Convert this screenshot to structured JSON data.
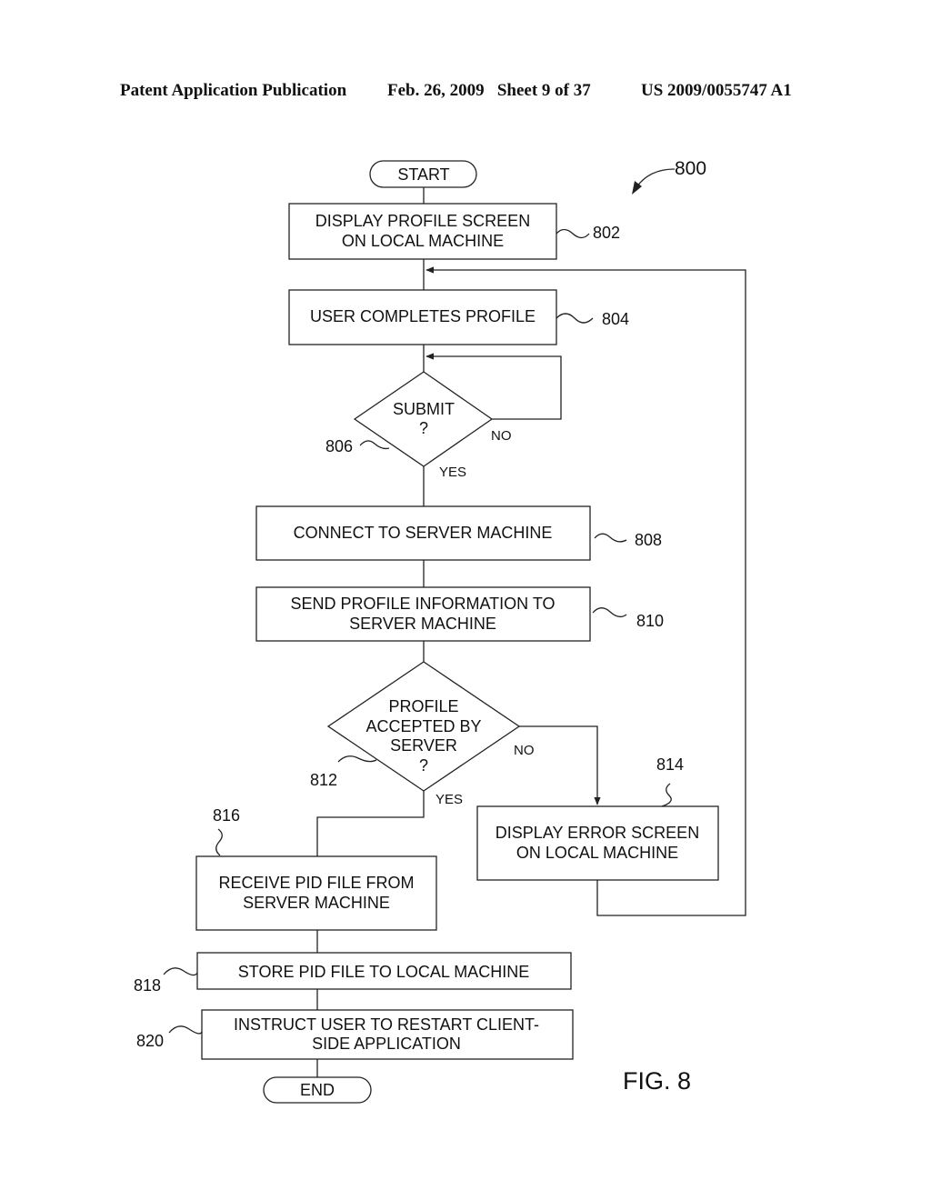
{
  "header": {
    "publication": "Patent Application Publication",
    "date_sheet": "Feb. 26, 2009   Sheet 9 of 37",
    "number": "US 2009/0055747 A1"
  },
  "figure": {
    "label": "FIG. 8",
    "ref": "800"
  },
  "nodes": {
    "start": {
      "lines": [
        "START"
      ]
    },
    "n802": {
      "ref": "802",
      "lines": [
        "DISPLAY PROFILE SCREEN",
        "ON LOCAL MACHINE"
      ]
    },
    "n804": {
      "ref": "804",
      "lines": [
        "USER COMPLETES PROFILE"
      ]
    },
    "n806": {
      "ref": "806",
      "lines": [
        "SUBMIT",
        "?"
      ],
      "yes": "YES",
      "no": "NO"
    },
    "n808": {
      "ref": "808",
      "lines": [
        "CONNECT TO SERVER MACHINE"
      ]
    },
    "n810": {
      "ref": "810",
      "lines": [
        "SEND PROFILE INFORMATION TO",
        "SERVER MACHINE"
      ]
    },
    "n812": {
      "ref": "812",
      "lines": [
        "PROFILE",
        "ACCEPTED BY",
        "SERVER",
        "?"
      ],
      "yes": "YES",
      "no": "NO"
    },
    "n814": {
      "ref": "814",
      "lines": [
        "DISPLAY ERROR SCREEN",
        "ON LOCAL MACHINE"
      ]
    },
    "n816": {
      "ref": "816",
      "lines": [
        "RECEIVE PID FILE FROM",
        "SERVER MACHINE"
      ]
    },
    "n818": {
      "ref": "818",
      "lines": [
        "STORE PID FILE TO LOCAL MACHINE"
      ]
    },
    "n820": {
      "ref": "820",
      "lines": [
        "INSTRUCT USER TO RESTART CLIENT-",
        "SIDE APPLICATION"
      ]
    },
    "end": {
      "lines": [
        "END"
      ]
    }
  }
}
